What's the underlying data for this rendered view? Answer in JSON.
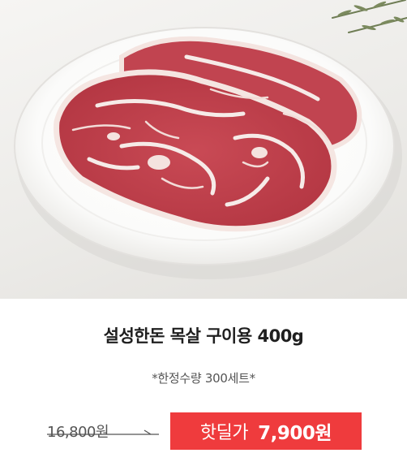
{
  "product": {
    "title": "설성한돈 목살 구이용 400g",
    "note": "*한정수량 300세트*",
    "original_price": "16,800원",
    "deal_label": "핫딜가",
    "deal_price": "7,900원"
  },
  "colors": {
    "deal_badge": "#ef3b3d",
    "title_text": "#1f1f1f",
    "muted_text": "#555555"
  },
  "icons": {
    "photo": "pork-neck-on-plate-image",
    "strike": "strikethrough-arrow-icon"
  }
}
